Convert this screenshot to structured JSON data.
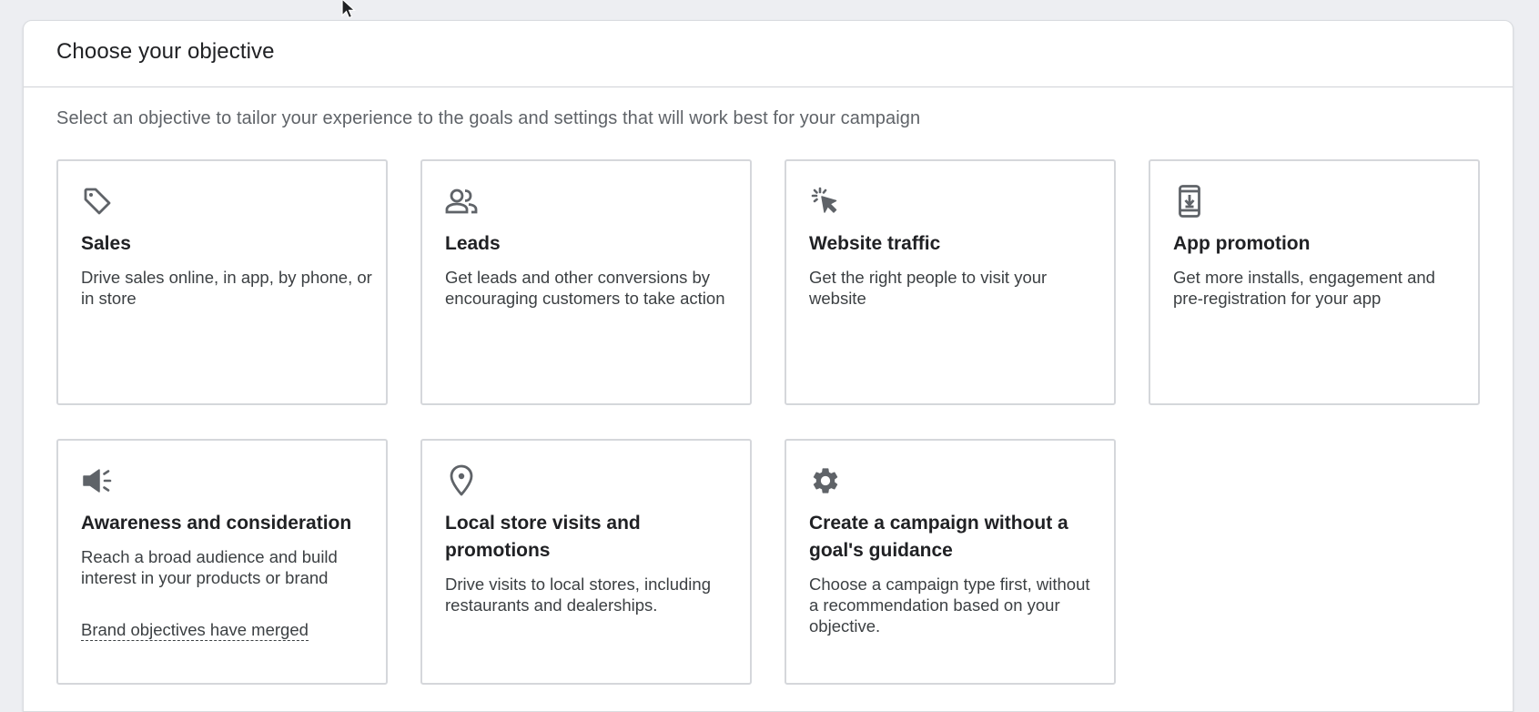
{
  "panel": {
    "title": "Choose your objective",
    "subtitle": "Select an objective to tailor your experience to the goals and settings that will work best for your campaign"
  },
  "cards": [
    {
      "icon": "tag-icon",
      "title": "Sales",
      "description": "Drive sales online, in app, by phone, or in store"
    },
    {
      "icon": "people-icon",
      "title": "Leads",
      "description": "Get leads and other conversions by encouraging customers to take action"
    },
    {
      "icon": "click-cursor-icon",
      "title": "Website traffic",
      "description": "Get the right people to visit your website"
    },
    {
      "icon": "phone-download-icon",
      "title": "App promotion",
      "description": "Get more installs, engagement and pre-registration for your app"
    },
    {
      "icon": "megaphone-icon",
      "title": "Awareness and consideration",
      "description": "Reach a broad audience and build interest in your products or brand",
      "link": "Brand objectives have merged"
    },
    {
      "icon": "location-pin-icon",
      "title": "Local store visits and promotions",
      "description": "Drive visits to local stores, including restaurants and dealerships."
    },
    {
      "icon": "gear-icon",
      "title": "Create a campaign without a goal's guidance",
      "description": "Choose a campaign type first, without a recommendation based on your objective."
    }
  ],
  "colors": {
    "background": "#edeef2",
    "card_border": "#d5d7db",
    "icon": "#5f6368",
    "text": "#202124"
  }
}
